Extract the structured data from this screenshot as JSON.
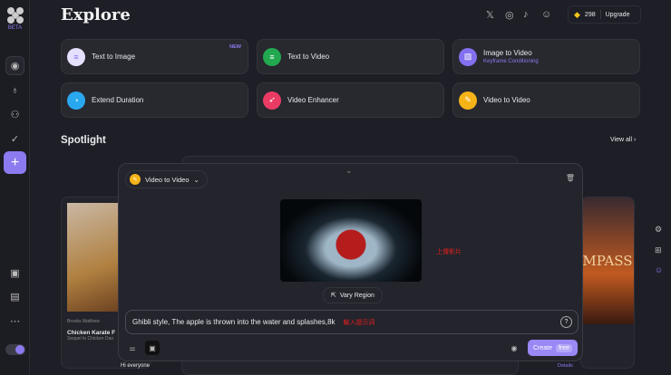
{
  "brand": {
    "badge": "BETA"
  },
  "header": {
    "title": "Explore",
    "credits": "298",
    "upgrade": "Upgrade"
  },
  "tools": [
    {
      "label": "Text to Image",
      "badge": "NEW",
      "color": "#e6e0ff"
    },
    {
      "label": "Text to Video",
      "color": "#22a84e"
    },
    {
      "label": "Image to Video",
      "sub": "Keyframe Conditioning",
      "color": "#8170f0"
    },
    {
      "label": "Extend Duration",
      "color": "#2aa8ef"
    },
    {
      "label": "Video Enhancer",
      "color": "#ea3b64"
    },
    {
      "label": "Video to Video",
      "color": "#f5b318"
    }
  ],
  "spotlight": {
    "title": "Spotlight",
    "view_all": "View all",
    "left_card": {
      "author": "Brooks Matthew",
      "title": "Chicken Karate F",
      "sub": "Sequel to Chicken Dan"
    },
    "bottom_text": "Hi everyone",
    "details": "Details",
    "right_card": {
      "text": "MPASS"
    }
  },
  "panel": {
    "mode": "Video to Video",
    "vary_region": "Vary Region",
    "prompt": "Ghibli style, The apple is thrown into the water and splashes,8k",
    "create": "Create",
    "free": "free",
    "annotation_upload": "上傳影片",
    "annotation_prompt": "輸入提示詞"
  }
}
